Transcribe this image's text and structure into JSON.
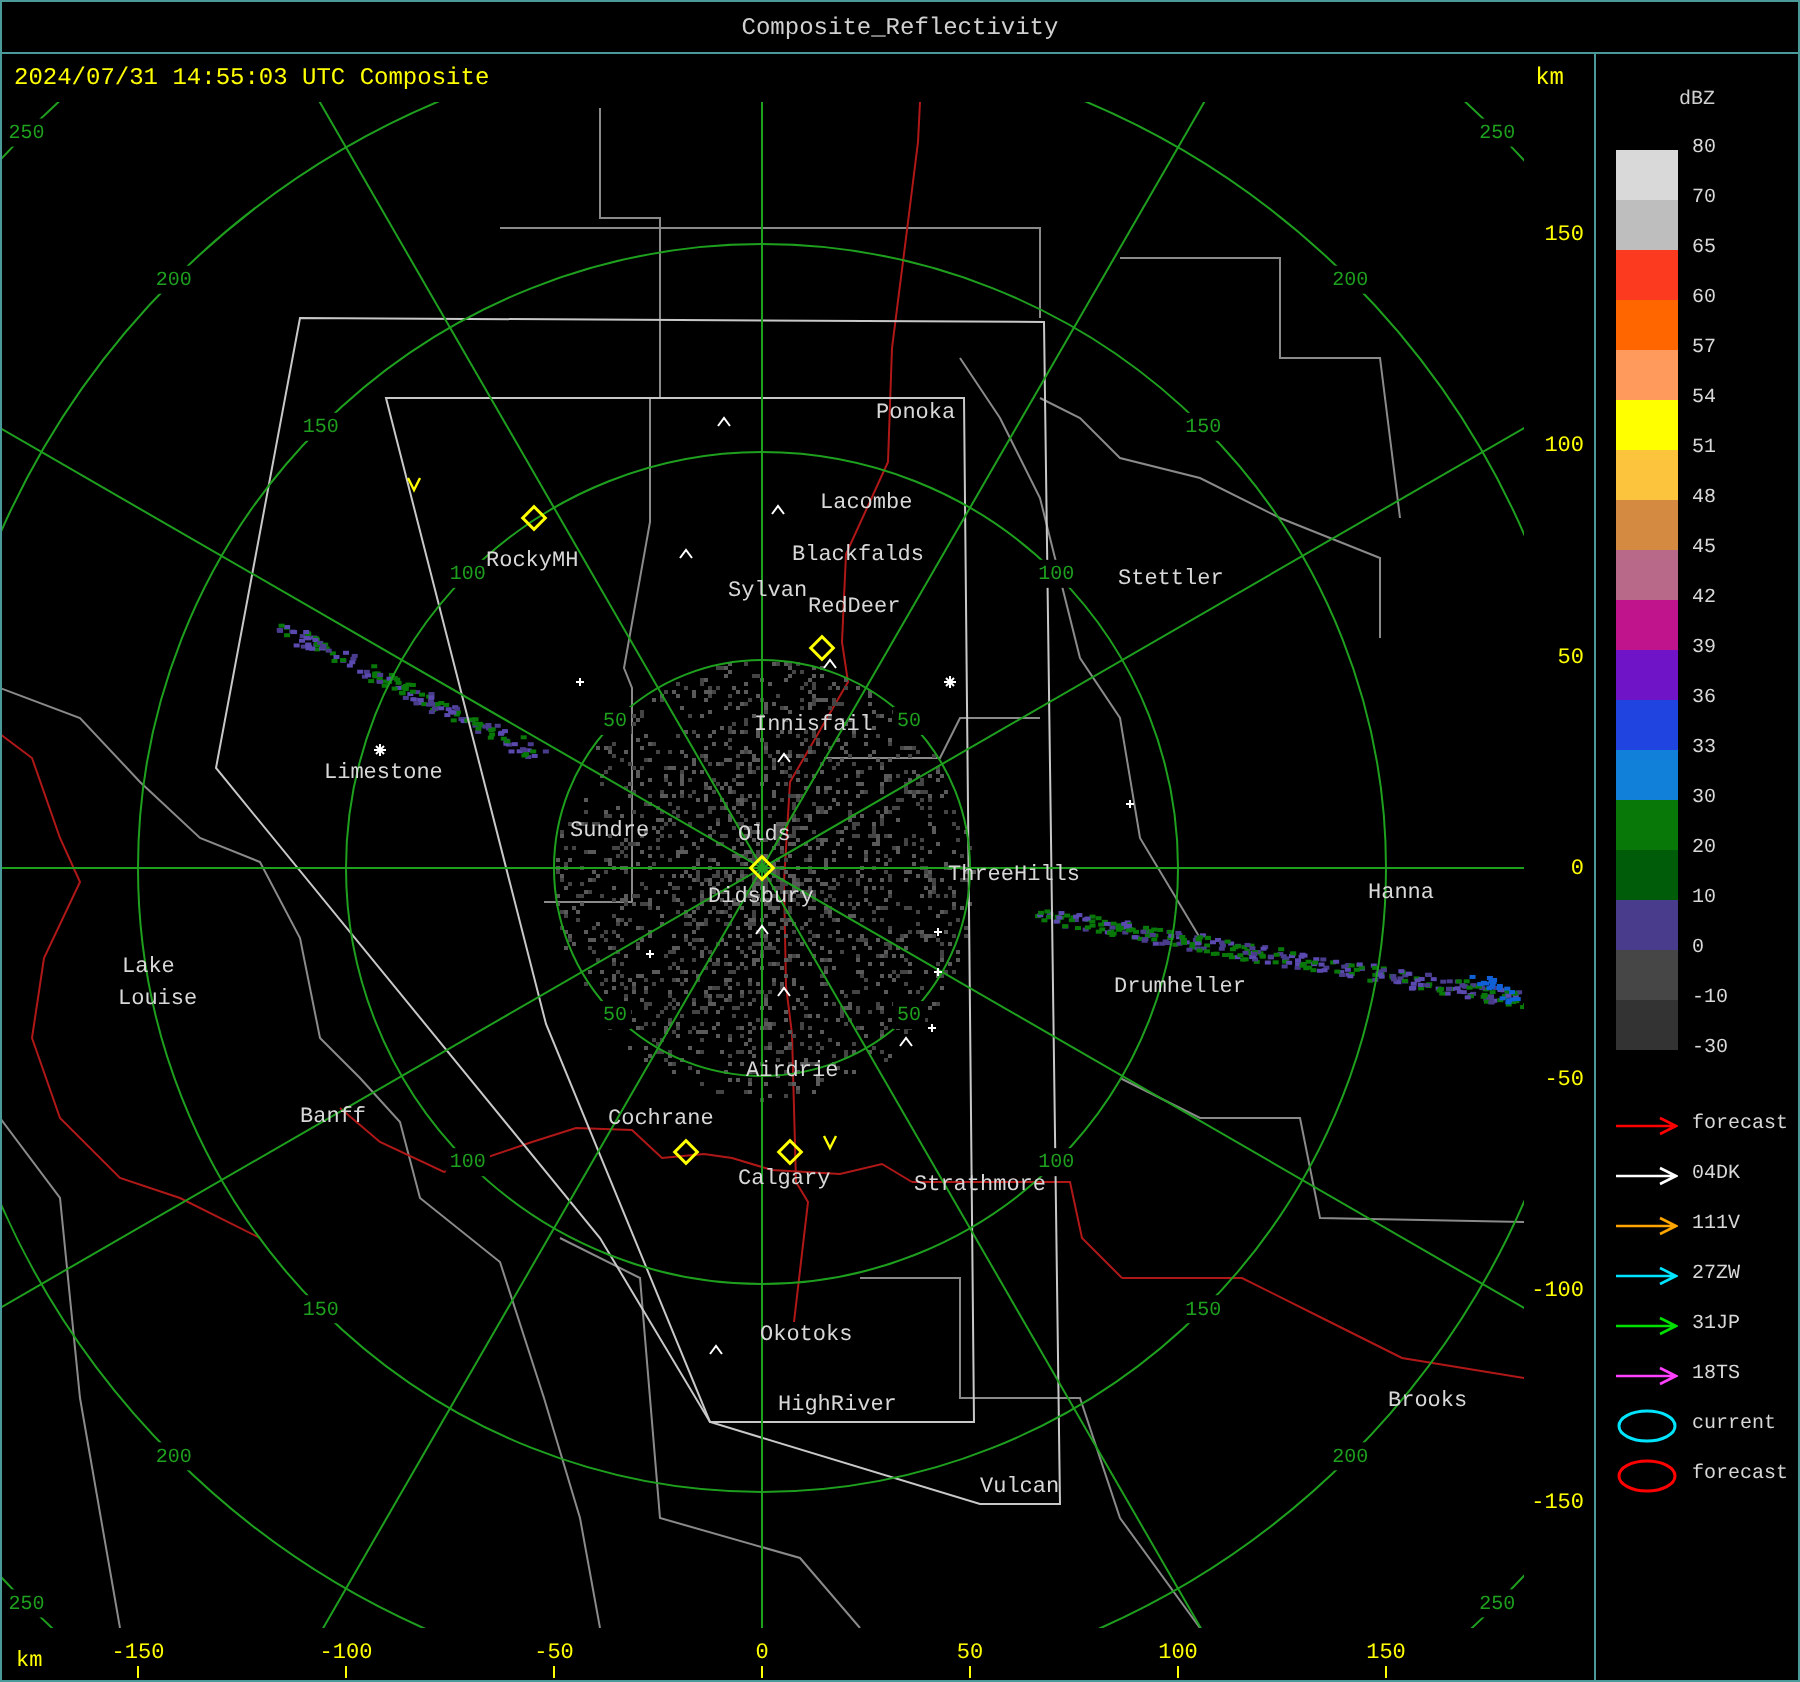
{
  "window": {
    "title": "Composite_Reflectivity"
  },
  "header": {
    "timestamp": "2024/07/31 14:55:03 UTC Composite",
    "y_unit": "km"
  },
  "map": {
    "towns": [
      "Ponoka",
      "Lacombe",
      "Blackfalds",
      "Sylvan",
      "RedDeer",
      "RockyMH",
      "Stettler",
      "Innisfail",
      "Limestone",
      "Sundre",
      "Olds",
      "Didsbury",
      "ThreeHills",
      "Hanna",
      "Lake",
      "Louise",
      "Drumheller",
      "Airdrie",
      "Banff",
      "Cochrane",
      "Calgary",
      "Strathmore",
      "Okotoks",
      "Brooks",
      "HighRiver",
      "Vulcan"
    ],
    "range_rings": [
      {
        "labels": [
          "50",
          "50",
          "50",
          "50"
        ]
      },
      {
        "labels": [
          "100",
          "100",
          "100",
          "100"
        ]
      },
      {
        "labels": [
          "150",
          "150",
          "150",
          "150"
        ]
      },
      {
        "labels": [
          "200",
          "200",
          "200",
          "200"
        ]
      },
      {
        "labels": [
          "250",
          "250",
          "250",
          "250"
        ]
      }
    ]
  },
  "y_axis": {
    "ticks": [
      "150",
      "100",
      "50",
      "0",
      "-50",
      "-100",
      "-150"
    ]
  },
  "x_axis": {
    "unit": "km",
    "ticks": [
      "-150",
      "-100",
      "-50",
      "0",
      "50",
      "100",
      "150"
    ]
  },
  "legend": {
    "title": "dBZ",
    "labels": [
      "80",
      "70",
      "65",
      "60",
      "57",
      "54",
      "51",
      "48",
      "45",
      "42",
      "39",
      "36",
      "33",
      "30",
      "20",
      "10",
      "0",
      "-10",
      "-30"
    ],
    "bands": [
      {
        "color": "#d9d9d9"
      },
      {
        "color": "#bebebe"
      },
      {
        "color": "#fc3a20"
      },
      {
        "color": "#ff6600"
      },
      {
        "color": "#ff9a5c"
      },
      {
        "color": "#ffff00"
      },
      {
        "color": "#fcc43c"
      },
      {
        "color": "#d48a40"
      },
      {
        "color": "#b86888"
      },
      {
        "color": "#c0148c"
      },
      {
        "color": "#7014c8"
      },
      {
        "color": "#2044e0"
      },
      {
        "color": "#1080d8"
      },
      {
        "color": "#087808"
      },
      {
        "color": "#005c08"
      },
      {
        "color": "#4a3c8c"
      },
      {
        "color": "#464646"
      },
      {
        "color": "#333333"
      }
    ],
    "keys": [
      {
        "kind": "arrow",
        "label": "forecast",
        "color": "#ff0000"
      },
      {
        "kind": "arrow",
        "label": "04DK",
        "color": "#ffffff"
      },
      {
        "kind": "arrow",
        "label": "111V",
        "color": "#ffa500"
      },
      {
        "kind": "arrow",
        "label": "27ZW",
        "color": "#00e5ff"
      },
      {
        "kind": "arrow",
        "label": "31JP",
        "color": "#00e000"
      },
      {
        "kind": "arrow",
        "label": "18TS",
        "color": "#ff40ff"
      },
      {
        "kind": "ellipse",
        "label": "current",
        "color": "#00e5ff"
      },
      {
        "kind": "ellipse",
        "label": "forecast",
        "color": "#ff0000"
      }
    ]
  }
}
